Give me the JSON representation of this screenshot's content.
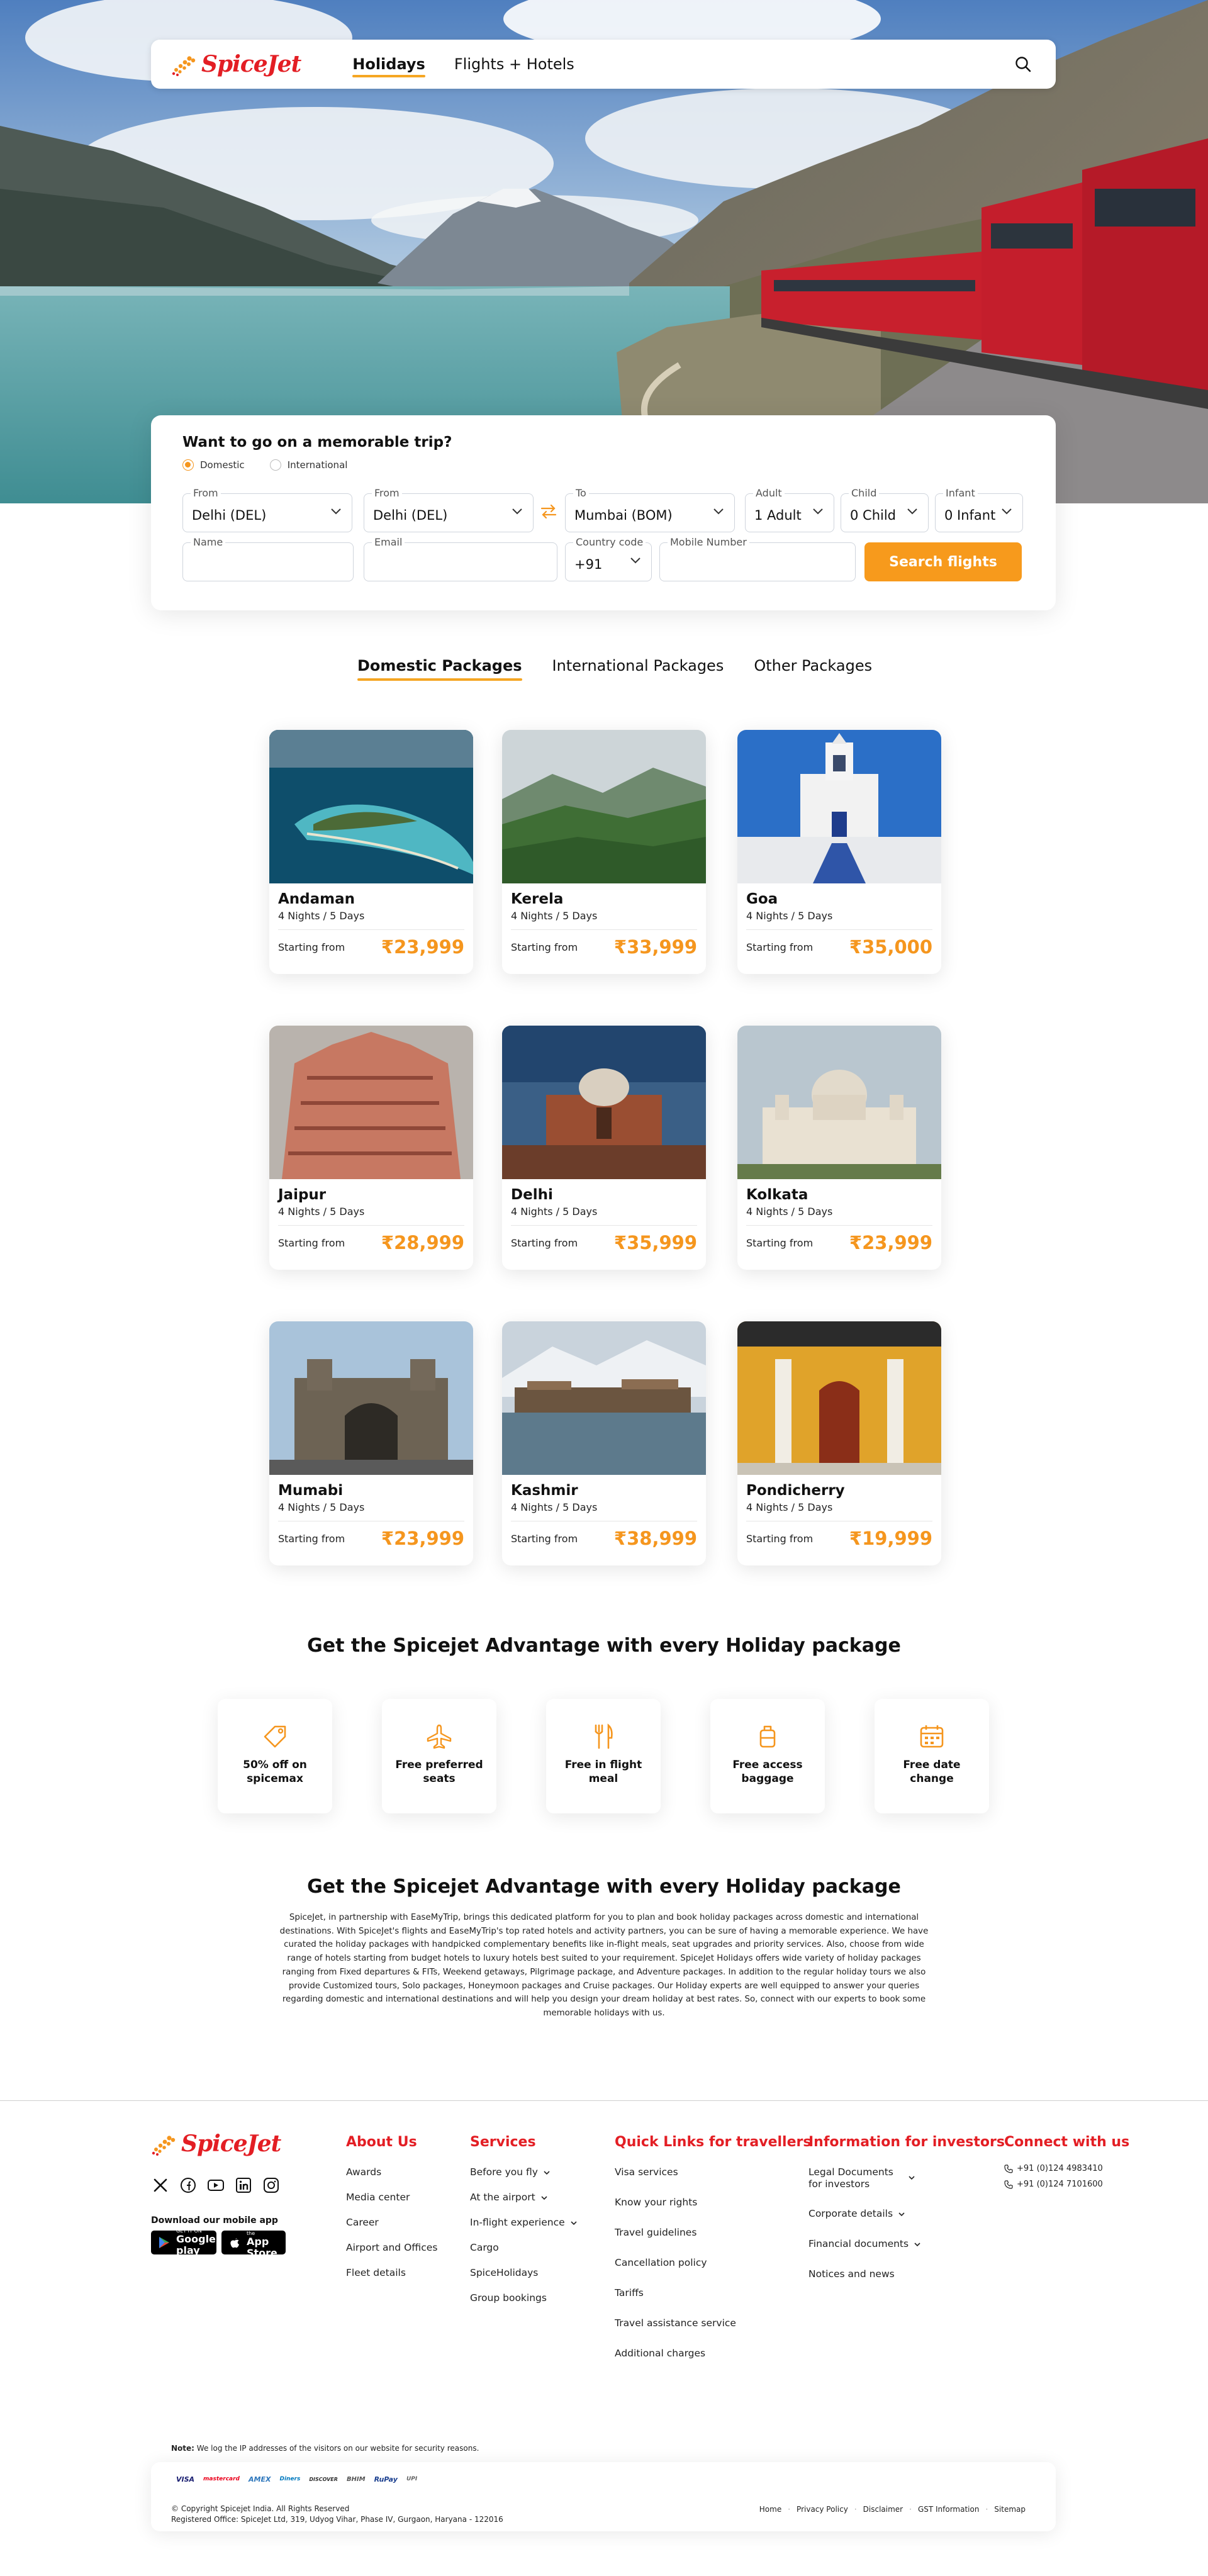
{
  "brand": {
    "name": "SpiceJet",
    "color": "#e31e24",
    "accent": "#f5961e"
  },
  "nav": {
    "tabs": [
      {
        "label": "Holidays",
        "active": true
      },
      {
        "label": "Flights + Hotels",
        "active": false
      }
    ],
    "search_icon": "search-icon"
  },
  "search": {
    "title": "Want to go on a memorable trip?",
    "trip_types": [
      {
        "label": "Domestic",
        "selected": true
      },
      {
        "label": "International",
        "selected": false
      }
    ],
    "from1": {
      "label": "From",
      "value": "Delhi (DEL)"
    },
    "from2": {
      "label": "From",
      "value": "Delhi (DEL)"
    },
    "to": {
      "label": "To",
      "value": "Mumbai (BOM)"
    },
    "adult": {
      "label": "Adult",
      "value": "1 Adult"
    },
    "child": {
      "label": "Child",
      "value": "0 Child"
    },
    "infant": {
      "label": "Infant",
      "value": "0 Infant"
    },
    "name": {
      "label": "Name",
      "value": ""
    },
    "email": {
      "label": "Email",
      "value": ""
    },
    "country_code": {
      "label": "Country code",
      "value": "+91"
    },
    "mobile": {
      "label": "Mobile Number",
      "value": ""
    },
    "button": "Search flights"
  },
  "package_tabs": [
    {
      "label": "Domestic Packages",
      "active": true
    },
    {
      "label": "International Packages",
      "active": false
    },
    {
      "label": "Other Packages",
      "active": false
    }
  ],
  "packages": [
    {
      "name": "Andaman",
      "nights": "4 Nights / 5 Days",
      "from": "Starting from",
      "price": "₹23,999",
      "scene": "island"
    },
    {
      "name": "Kerela",
      "nights": "4 Nights / 5 Days",
      "from": "Starting from",
      "price": "₹33,999",
      "scene": "hills"
    },
    {
      "name": "Goa",
      "nights": "4 Nights / 5 Days",
      "from": "Starting from",
      "price": "₹35,000",
      "scene": "church"
    },
    {
      "name": "Jaipur",
      "nights": "4 Nights / 5 Days",
      "from": "Starting from",
      "price": "₹28,999",
      "scene": "palace"
    },
    {
      "name": "Delhi",
      "nights": "4 Nights / 5 Days",
      "from": "Starting from",
      "price": "₹35,999",
      "scene": "tomb"
    },
    {
      "name": "Kolkata",
      "nights": "4 Nights / 5 Days",
      "from": "Starting from",
      "price": "₹23,999",
      "scene": "memorial"
    },
    {
      "name": "Mumabi",
      "nights": "4 Nights / 5 Days",
      "from": "Starting from",
      "price": "₹23,999",
      "scene": "gateway"
    },
    {
      "name": "Kashmir",
      "nights": "4 Nights / 5 Days",
      "from": "Starting from",
      "price": "₹38,999",
      "scene": "lake"
    },
    {
      "name": "Pondicherry",
      "nights": "4 Nights / 5 Days",
      "from": "Starting from",
      "price": "₹19,999",
      "scene": "house"
    }
  ],
  "advantage": {
    "title": "Get the Spicejet Advantage with every Holiday package",
    "items": [
      {
        "label": "50% off on spicemax",
        "icon": "tag-icon"
      },
      {
        "label": "Free preferred seats",
        "icon": "plane-icon"
      },
      {
        "label": "Free in flight meal",
        "icon": "fork-knife-icon"
      },
      {
        "label": "Free access baggage",
        "icon": "baggage-icon"
      },
      {
        "label": "Free date change",
        "icon": "calendar-icon"
      }
    ]
  },
  "about": {
    "title": "Get the Spicejet Advantage with every Holiday package",
    "text": "SpiceJet, in partnership with EaseMyTrip, brings this dedicated platform for you to plan and book holiday packages across domestic and international destinations. With SpiceJet's flights and EaseMyTrip's top rated hotels and activity partners, you can be sure of having a memorable experience. We have curated the holiday packages with handpicked complementary benefits like in-flight meals, seat upgrades and priority services. Also, choose from wide range of hotels starting from budget hotels to luxury hotels best suited to your requirement. SpiceJet Holidays offers wide variety of holiday packages ranging from Fixed departures & FITs, Weekend getaways, Pilgrimage package, and Adventure packages. In addition to the regular holiday tours we also provide Customized tours, Solo packages, Honeymoon packages and Cruise packages. Our Holiday experts are well equipped to answer your queries regarding domestic and international destinations and will help you design your dream holiday at best rates. So, connect with our experts to book some memorable holidays with us."
  },
  "footer": {
    "download_label": "Download our mobile app",
    "google_play": {
      "small": "GET IT ON",
      "big": "Google play"
    },
    "app_store": {
      "small": "Download on the",
      "big": "App Store"
    },
    "about_us": {
      "title": "About Us",
      "links": [
        "Awards",
        "Media center",
        "Career",
        "Airport and Offices",
        "Fleet details"
      ]
    },
    "services": {
      "title": "Services",
      "links": [
        "Before you fly",
        "At the airport",
        "In-flight experience",
        "Cargo",
        "SpiceHolidays",
        "Group bookings"
      ]
    },
    "quick_links": {
      "title": "Quick Links for travellers",
      "links": [
        "Visa services",
        "Know your rights",
        "Travel guidelines",
        "Cancellation policy",
        "Tariffs",
        "Travel assistance service",
        "Additional charges"
      ]
    },
    "investors": {
      "title": "Information for investors",
      "links": [
        "Legal Documents for investors",
        "Corporate details",
        "Financial documents",
        "Notices and news"
      ]
    },
    "connect": {
      "title": "Connect with us",
      "phones": [
        "+91 (0)124 4983410",
        "+91 (0)124 7101600"
      ]
    },
    "note_bold": "Note:",
    "note": "We log the IP addresses of the visitors on our website for security reasons.",
    "payments": [
      "VISA",
      "mastercard",
      "AMEX",
      "Diners",
      "DISCOVER",
      "BHIM",
      "RuPay",
      "UPI"
    ],
    "copyright": "© Copyright Spicejet India. All Rights Reserved",
    "address": "Registered Office: SpiceJet Ltd, 319, Udyog Vihar, Phase IV, Gurgaon, Haryana - 122016",
    "legal_links": [
      "Home",
      "Privacy Policy",
      "Disclaimer",
      "GST Information",
      "Sitemap"
    ]
  }
}
